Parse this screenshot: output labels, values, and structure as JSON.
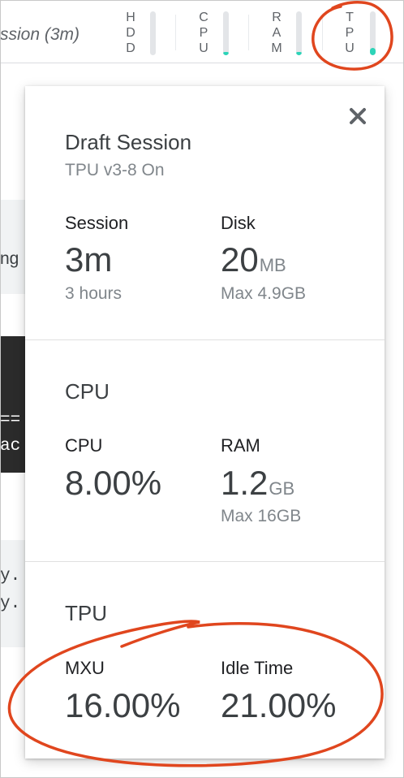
{
  "topbar": {
    "session_label": "ssion (3m)",
    "meters": [
      {
        "letters": [
          "H",
          "D",
          "D"
        ],
        "level": 0.0
      },
      {
        "letters": [
          "C",
          "P",
          "U"
        ],
        "level": 0.08
      },
      {
        "letters": [
          "R",
          "A",
          "M"
        ],
        "level": 0.08
      },
      {
        "letters": [
          "T",
          "P",
          "U"
        ],
        "level": 0.16
      }
    ]
  },
  "background": {
    "text_ng": "ng",
    "code_eq": "==",
    "code_ac": "ac",
    "mono_y1": "y.",
    "mono_y2": "y."
  },
  "card": {
    "session_section": {
      "title": "Draft Session",
      "subtitle": "TPU v3-8 On",
      "session_label": "Session",
      "session_value": "3m",
      "session_sub": "3 hours",
      "disk_label": "Disk",
      "disk_value": "20",
      "disk_unit": "MB",
      "disk_sub": "Max 4.9GB"
    },
    "cpu_section": {
      "title": "CPU",
      "cpu_label": "CPU",
      "cpu_value": "8.00%",
      "ram_label": "RAM",
      "ram_value": "1.2",
      "ram_unit": "GB",
      "ram_sub": "Max 16GB"
    },
    "tpu_section": {
      "title": "TPU",
      "mxu_label": "MXU",
      "mxu_value": "16.00%",
      "idle_label": "Idle Time",
      "idle_value": "21.00%"
    }
  },
  "colors": {
    "meter_fill": "#2cd4b8",
    "annotation": "#e0461e"
  }
}
